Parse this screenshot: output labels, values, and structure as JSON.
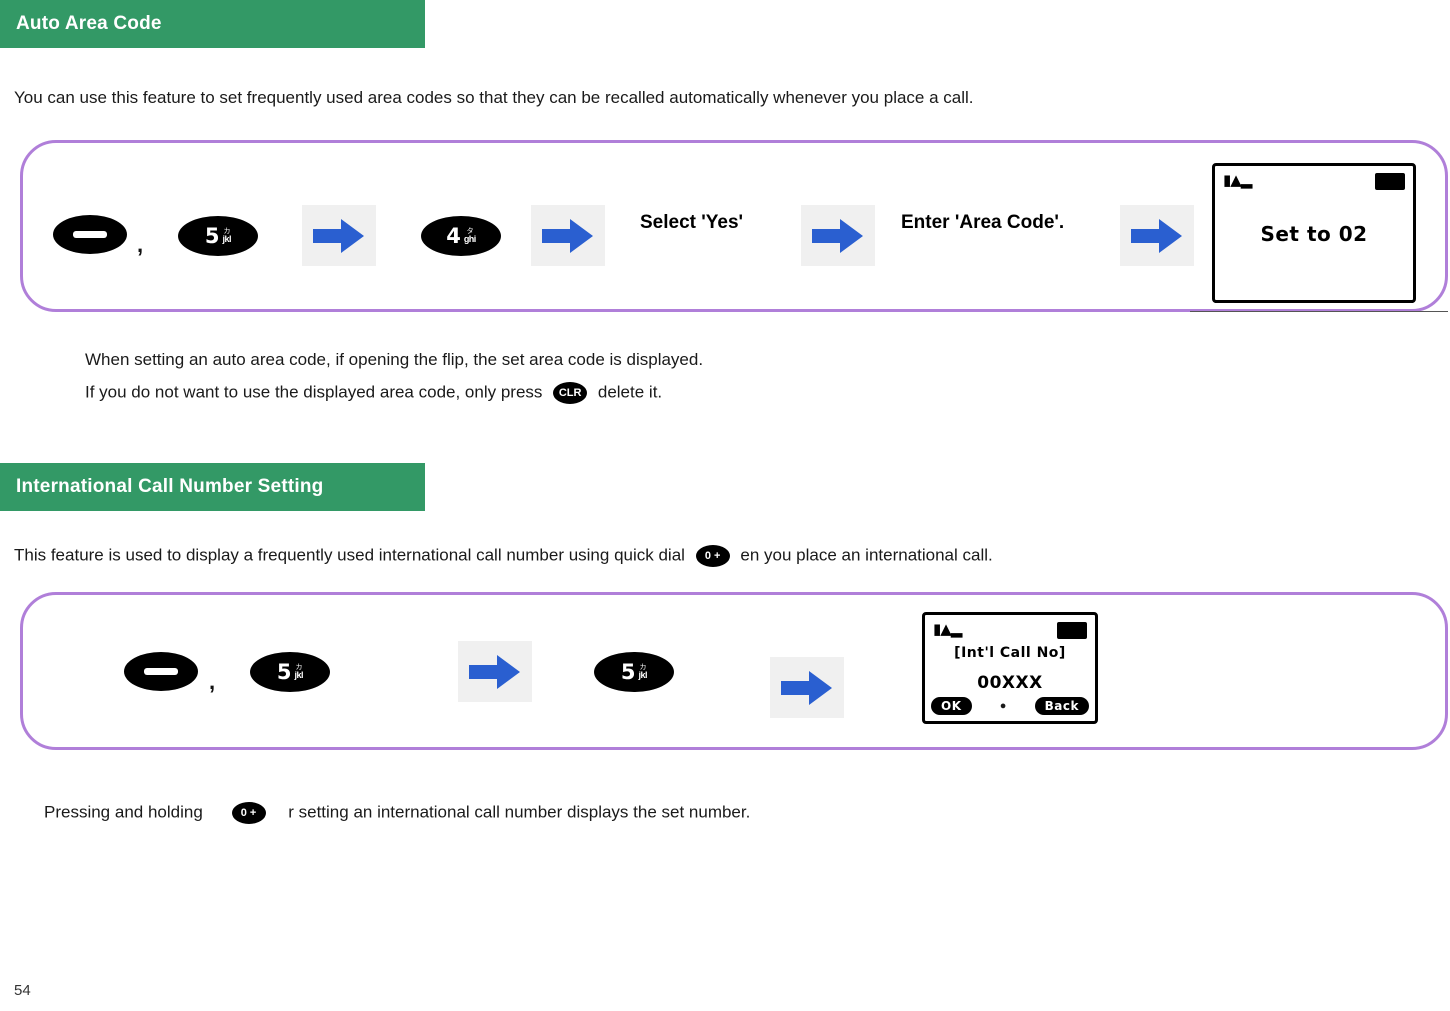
{
  "page": {
    "number": "54"
  },
  "sections": [
    {
      "id": "auto-area-code",
      "title": "Auto Area Code",
      "intro": "You can use this feature to set frequently used area codes so that they can be recalled automatically whenever you place a call.",
      "flow": {
        "steps": [
          {
            "type": "key-menu",
            "label": "menu-key"
          },
          {
            "type": "comma",
            "label": ","
          },
          {
            "type": "key-num",
            "digit": "5",
            "sub_top": "カ",
            "sub_bot": "jkl"
          },
          {
            "type": "arrow",
            "label": "arrow-right"
          },
          {
            "type": "key-num",
            "digit": "4",
            "sub_top": "タ",
            "sub_bot": "ghi"
          },
          {
            "type": "arrow",
            "label": "arrow-right"
          },
          {
            "type": "text",
            "label": "Select 'Yes'"
          },
          {
            "type": "arrow",
            "label": "arrow-right"
          },
          {
            "type": "text",
            "label": "Enter 'Area Code'."
          },
          {
            "type": "arrow",
            "label": "arrow-right"
          },
          {
            "type": "lcd",
            "label": "Set to 02"
          }
        ]
      },
      "notes": [
        "When setting an auto area code, if opening the flip, the set area code is displayed.",
        {
          "before": "If you do not want to use the displayed area code, only press",
          "key": "CLR",
          "after": "delete it."
        }
      ]
    },
    {
      "id": "international-call-number-setting",
      "title": "International Call Number Setting",
      "intro": {
        "before": "This feature is used to display a frequently used international call number using quick dial",
        "key": "0 +",
        "after": "en you place an international call."
      },
      "flow": {
        "steps": [
          {
            "type": "key-menu",
            "label": "menu-key"
          },
          {
            "type": "comma",
            "label": ","
          },
          {
            "type": "key-num",
            "digit": "5",
            "sub_top": "カ",
            "sub_bot": "jkl"
          },
          {
            "type": "arrow",
            "label": "arrow-right"
          },
          {
            "type": "key-num",
            "digit": "5",
            "sub_top": "カ",
            "sub_bot": "jkl"
          },
          {
            "type": "arrow",
            "label": "arrow-right"
          },
          {
            "type": "lcd",
            "title": "[Int'l Call No]",
            "value": "00XXX",
            "softkey_left": "OK",
            "softkey_right": "Back"
          }
        ]
      },
      "notes": [
        {
          "before": "Pressing and holding",
          "key": "0 +",
          "after": "r setting an international call number displays the set number."
        }
      ]
    }
  ],
  "colors": {
    "section_bar": "#339966",
    "flowbox_border": "#b07fd9",
    "arrow": "#2a5fd0",
    "arrow_tile": "#f0f0f0"
  }
}
